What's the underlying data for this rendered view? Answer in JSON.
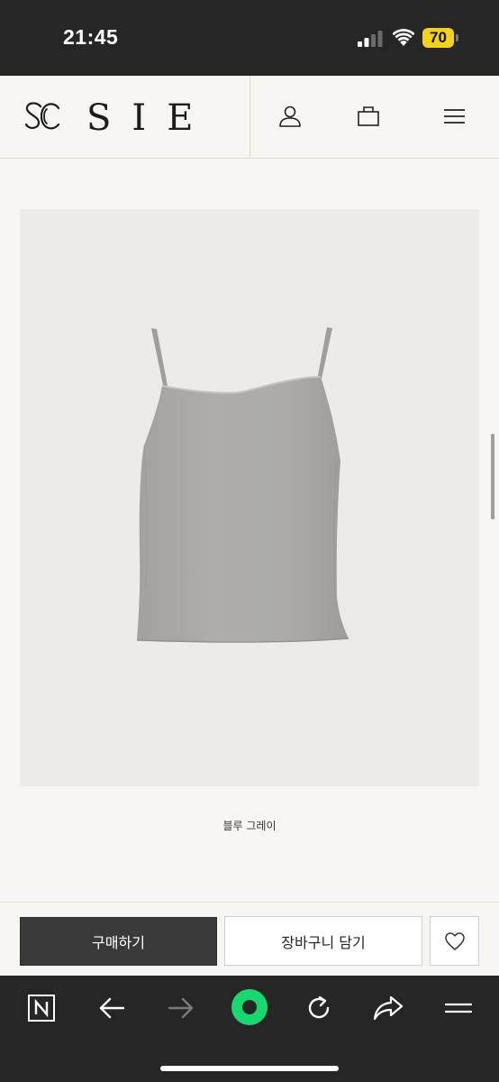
{
  "status_bar": {
    "time": "21:45",
    "battery_level": "70",
    "battery_color": "#f3d21a"
  },
  "header": {
    "logo_text": "SIE",
    "icons": [
      "user-icon",
      "shopping-bag-icon",
      "menu-icon"
    ]
  },
  "product": {
    "image_subject": "grey camisole top",
    "color_label": "블루 그레이"
  },
  "actions": {
    "buy_label": "구매하기",
    "cart_label": "장바구니 담기",
    "wishlist_icon": "heart-icon"
  },
  "browser_toolbar": {
    "icons": [
      "naver-n-icon",
      "back-arrow-icon",
      "forward-arrow-icon",
      "green-dot-icon",
      "reload-icon",
      "share-icon",
      "menu-lines-icon"
    ],
    "accent": "#19d86f"
  }
}
